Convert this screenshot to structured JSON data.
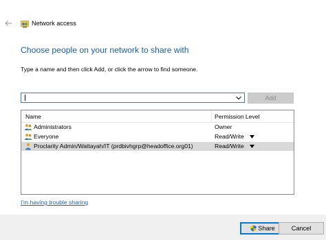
{
  "window": {
    "title": "Network access",
    "back_icon": "back-arrow-icon",
    "app_icon": "network-share-icon"
  },
  "main": {
    "heading": "Choose people on your network to share with",
    "instruction": "Type a name and then click Add, or click the arrow to find someone.",
    "name_input": {
      "value": "",
      "placeholder": ""
    },
    "add_label": "Add"
  },
  "table": {
    "headers": {
      "name": "Name",
      "permission": "Permission Level"
    },
    "rows": [
      {
        "name": "Administrators",
        "permission": "Owner",
        "has_dropdown": false,
        "icon": "user-group-icon",
        "selected": false
      },
      {
        "name": "Everyone",
        "permission": "Read/Write",
        "has_dropdown": true,
        "icon": "user-group-icon",
        "selected": false
      },
      {
        "name": "Proclarity Admin/Wattayah/IT (prdbivhgrp@headoffice.org01)",
        "permission": "Read/Write",
        "has_dropdown": true,
        "icon": "user-icon",
        "selected": true
      }
    ]
  },
  "footer": {
    "trouble_link": "I'm having trouble sharing",
    "share_label": "Share",
    "cancel_label": "Cancel"
  },
  "colors": {
    "heading": "#1a5ca3",
    "link": "#1f63ad",
    "accent": "#0078d7",
    "selected_row": "#d9d9d9",
    "footer_bg": "#f0f0f0"
  }
}
